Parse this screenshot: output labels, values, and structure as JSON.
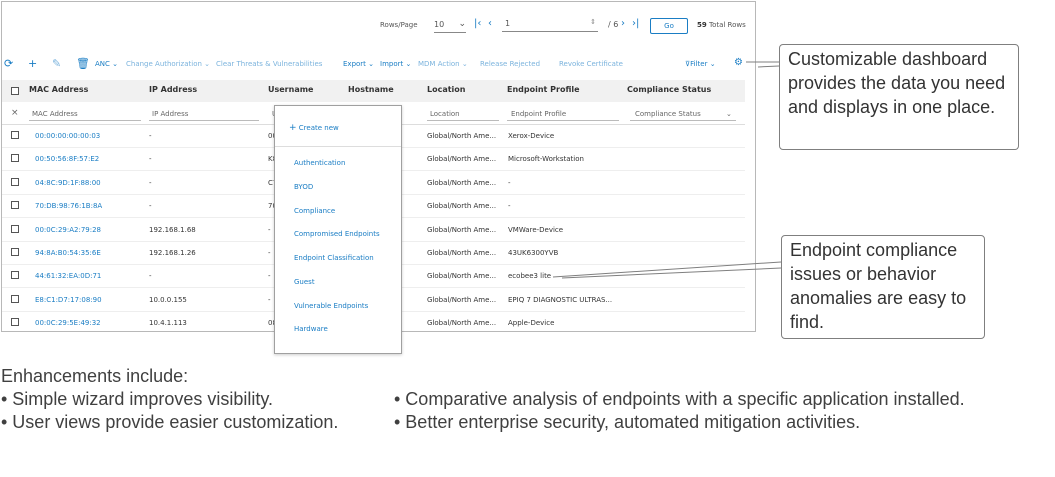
{
  "pagination": {
    "rows_per_page_label": "Rows/Page",
    "rows_per_page_value": "10",
    "page_input": "1",
    "page_total": "/ 6",
    "go_label": "Go",
    "total_count": "59",
    "total_label": "Total Rows"
  },
  "toolbar": {
    "anc": "ANC",
    "change_authorization": "Change Authorization",
    "clear_threats": "Clear Threats & Vulnerabilities",
    "export": "Export",
    "import": "Import",
    "mdm_action": "MDM Action",
    "release_rejected": "Release Rejected",
    "revoke_certificate": "Revoke Certificate",
    "filter": "Filter"
  },
  "table": {
    "headers": {
      "mac": "MAC Address",
      "ip": "IP Address",
      "username": "Username",
      "hostname": "Hostname",
      "location": "Location",
      "profile": "Endpoint Profile",
      "compliance": "Compliance Status"
    },
    "filters": {
      "mac": "MAC Address",
      "ip": "IP Address",
      "username": "U",
      "location": "Location",
      "profile": "Endpoint Profile",
      "compliance": "Compliance Status"
    },
    "rows": [
      {
        "mac": "00:00:00:00:00:03",
        "ip": "-",
        "user": "00",
        "location": "Global/North Ame...",
        "profile": "Xerox-Device"
      },
      {
        "mac": "00:50:56:8F:57:E2",
        "ip": "-",
        "user": "K8",
        "location": "Global/North Ame...",
        "profile": "Microsoft-Workstation"
      },
      {
        "mac": "04:8C:9D:1F:88:00",
        "ip": "-",
        "user": "C7",
        "location": "Global/North Ame...",
        "profile": "-"
      },
      {
        "mac": "70:DB:98:76:1B:8A",
        "ip": "-",
        "user": "70",
        "location": "Global/North Ame...",
        "profile": "-"
      },
      {
        "mac": "00:0C:29:A2:79:28",
        "ip": "192.168.1.68",
        "user": "-",
        "location": "Global/North Ame...",
        "profile": "VMWare-Device"
      },
      {
        "mac": "94:8A:B0:54:35:6E",
        "ip": "192.168.1.26",
        "user": "-",
        "location": "Global/North Ame...",
        "profile": "43UK6300YVB"
      },
      {
        "mac": "44:61:32:EA:0D:71",
        "ip": "-",
        "user": "-",
        "location": "Global/North Ame...",
        "profile": "ecobee3 lite"
      },
      {
        "mac": "E8:C1:D7:17:08:90",
        "ip": "10.0.0.155",
        "user": "-",
        "location": "Global/North Ame...",
        "profile": "EPIQ 7 DIAGNOSTIC ULTRAS..."
      },
      {
        "mac": "00:0C:29:5E:49:32",
        "ip": "10.4.1.113",
        "user": "08",
        "location": "Global/North Ame...",
        "profile": "Apple-Device"
      }
    ]
  },
  "dropdown": {
    "create_new": "Create new",
    "items": [
      "Authentication",
      "BYOD",
      "Compliance",
      "Compromised Endpoints",
      "Endpoint Classification",
      "Guest",
      "Vulnerable Endpoints",
      "Hardware"
    ]
  },
  "callouts": {
    "dashboard": "Customizable dashboard provides the data you need and displays in one place.",
    "compliance": "Endpoint compliance issues or behavior anomalies are easy to find."
  },
  "notes": {
    "heading": "Enhancements include:",
    "left": [
      "• Simple wizard improves visibility.",
      "• User views provide easier customization."
    ],
    "right": [
      "• Comparative analysis of endpoints with a specific application installed.",
      "• Better enterprise security, automated mitigation activities."
    ]
  },
  "colors": {
    "accent": "#1a7dc4",
    "border": "#7f7f7f"
  }
}
